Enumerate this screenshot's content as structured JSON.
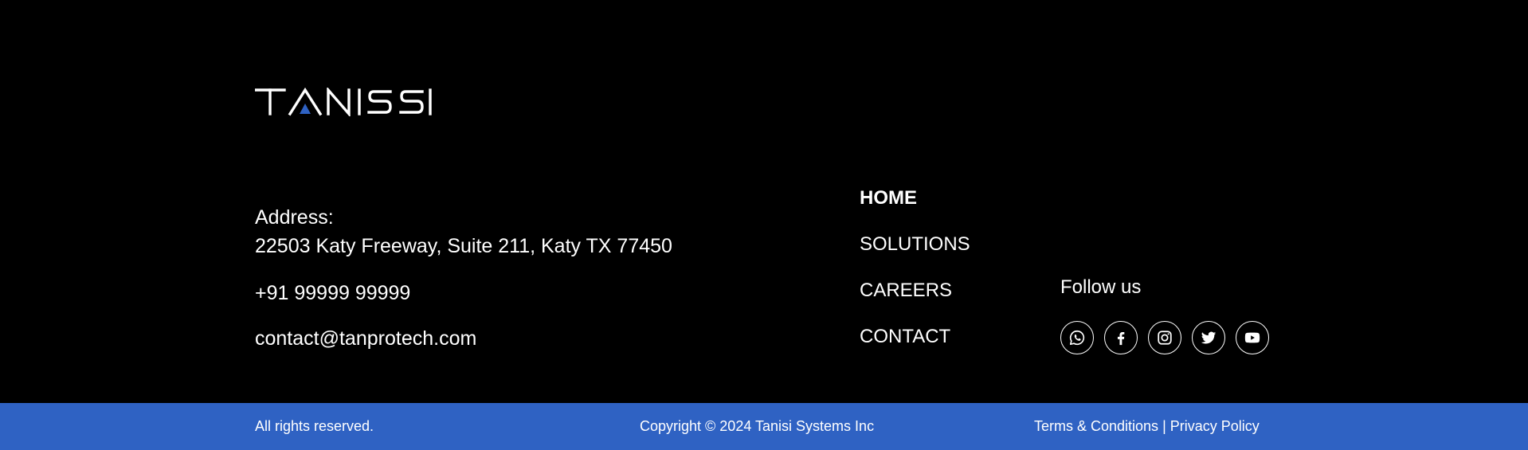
{
  "brand": {
    "name": "TANISI",
    "accent_color": "#2f62c3"
  },
  "contact": {
    "address_label": "Address:",
    "address_value": "22503 Katy Freeway, Suite 211, Katy TX 77450",
    "phone": "+91 99999 99999",
    "email": "contact@tanprotech.com"
  },
  "nav": {
    "items": [
      {
        "label": "HOME",
        "active": true
      },
      {
        "label": "SOLUTIONS",
        "active": false
      },
      {
        "label": "CAREERS",
        "active": false
      },
      {
        "label": "CONTACT",
        "active": false
      }
    ]
  },
  "social": {
    "title": "Follow us",
    "icons": [
      "whatsapp-icon",
      "facebook-icon",
      "instagram-icon",
      "twitter-icon",
      "youtube-icon"
    ]
  },
  "footer": {
    "rights": "All rights reserved.",
    "copyright": "Copyright © 2024 Tanisi Systems Inc",
    "terms": "Terms & Conditions",
    "separator": "|",
    "privacy": "Privacy Policy",
    "bar_color": "#2f62c3"
  }
}
